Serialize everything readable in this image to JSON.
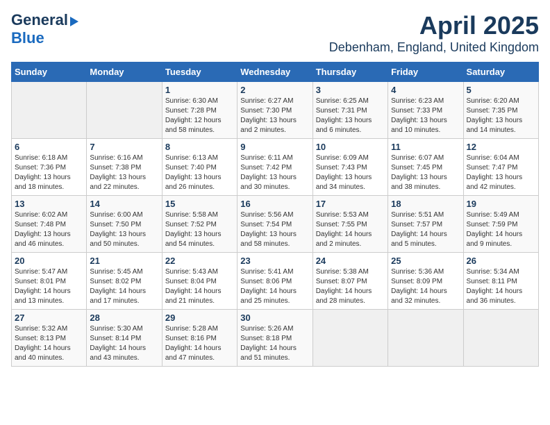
{
  "header": {
    "logo_line1": "General",
    "logo_line2": "Blue",
    "title": "April 2025",
    "subtitle": "Debenham, England, United Kingdom"
  },
  "calendar": {
    "days_of_week": [
      "Sunday",
      "Monday",
      "Tuesday",
      "Wednesday",
      "Thursday",
      "Friday",
      "Saturday"
    ],
    "weeks": [
      [
        {
          "day": "",
          "info": ""
        },
        {
          "day": "",
          "info": ""
        },
        {
          "day": "1",
          "info": "Sunrise: 6:30 AM\nSunset: 7:28 PM\nDaylight: 12 hours\nand 58 minutes."
        },
        {
          "day": "2",
          "info": "Sunrise: 6:27 AM\nSunset: 7:30 PM\nDaylight: 13 hours\nand 2 minutes."
        },
        {
          "day": "3",
          "info": "Sunrise: 6:25 AM\nSunset: 7:31 PM\nDaylight: 13 hours\nand 6 minutes."
        },
        {
          "day": "4",
          "info": "Sunrise: 6:23 AM\nSunset: 7:33 PM\nDaylight: 13 hours\nand 10 minutes."
        },
        {
          "day": "5",
          "info": "Sunrise: 6:20 AM\nSunset: 7:35 PM\nDaylight: 13 hours\nand 14 minutes."
        }
      ],
      [
        {
          "day": "6",
          "info": "Sunrise: 6:18 AM\nSunset: 7:36 PM\nDaylight: 13 hours\nand 18 minutes."
        },
        {
          "day": "7",
          "info": "Sunrise: 6:16 AM\nSunset: 7:38 PM\nDaylight: 13 hours\nand 22 minutes."
        },
        {
          "day": "8",
          "info": "Sunrise: 6:13 AM\nSunset: 7:40 PM\nDaylight: 13 hours\nand 26 minutes."
        },
        {
          "day": "9",
          "info": "Sunrise: 6:11 AM\nSunset: 7:42 PM\nDaylight: 13 hours\nand 30 minutes."
        },
        {
          "day": "10",
          "info": "Sunrise: 6:09 AM\nSunset: 7:43 PM\nDaylight: 13 hours\nand 34 minutes."
        },
        {
          "day": "11",
          "info": "Sunrise: 6:07 AM\nSunset: 7:45 PM\nDaylight: 13 hours\nand 38 minutes."
        },
        {
          "day": "12",
          "info": "Sunrise: 6:04 AM\nSunset: 7:47 PM\nDaylight: 13 hours\nand 42 minutes."
        }
      ],
      [
        {
          "day": "13",
          "info": "Sunrise: 6:02 AM\nSunset: 7:48 PM\nDaylight: 13 hours\nand 46 minutes."
        },
        {
          "day": "14",
          "info": "Sunrise: 6:00 AM\nSunset: 7:50 PM\nDaylight: 13 hours\nand 50 minutes."
        },
        {
          "day": "15",
          "info": "Sunrise: 5:58 AM\nSunset: 7:52 PM\nDaylight: 13 hours\nand 54 minutes."
        },
        {
          "day": "16",
          "info": "Sunrise: 5:56 AM\nSunset: 7:54 PM\nDaylight: 13 hours\nand 58 minutes."
        },
        {
          "day": "17",
          "info": "Sunrise: 5:53 AM\nSunset: 7:55 PM\nDaylight: 14 hours\nand 2 minutes."
        },
        {
          "day": "18",
          "info": "Sunrise: 5:51 AM\nSunset: 7:57 PM\nDaylight: 14 hours\nand 5 minutes."
        },
        {
          "day": "19",
          "info": "Sunrise: 5:49 AM\nSunset: 7:59 PM\nDaylight: 14 hours\nand 9 minutes."
        }
      ],
      [
        {
          "day": "20",
          "info": "Sunrise: 5:47 AM\nSunset: 8:01 PM\nDaylight: 14 hours\nand 13 minutes."
        },
        {
          "day": "21",
          "info": "Sunrise: 5:45 AM\nSunset: 8:02 PM\nDaylight: 14 hours\nand 17 minutes."
        },
        {
          "day": "22",
          "info": "Sunrise: 5:43 AM\nSunset: 8:04 PM\nDaylight: 14 hours\nand 21 minutes."
        },
        {
          "day": "23",
          "info": "Sunrise: 5:41 AM\nSunset: 8:06 PM\nDaylight: 14 hours\nand 25 minutes."
        },
        {
          "day": "24",
          "info": "Sunrise: 5:38 AM\nSunset: 8:07 PM\nDaylight: 14 hours\nand 28 minutes."
        },
        {
          "day": "25",
          "info": "Sunrise: 5:36 AM\nSunset: 8:09 PM\nDaylight: 14 hours\nand 32 minutes."
        },
        {
          "day": "26",
          "info": "Sunrise: 5:34 AM\nSunset: 8:11 PM\nDaylight: 14 hours\nand 36 minutes."
        }
      ],
      [
        {
          "day": "27",
          "info": "Sunrise: 5:32 AM\nSunset: 8:13 PM\nDaylight: 14 hours\nand 40 minutes."
        },
        {
          "day": "28",
          "info": "Sunrise: 5:30 AM\nSunset: 8:14 PM\nDaylight: 14 hours\nand 43 minutes."
        },
        {
          "day": "29",
          "info": "Sunrise: 5:28 AM\nSunset: 8:16 PM\nDaylight: 14 hours\nand 47 minutes."
        },
        {
          "day": "30",
          "info": "Sunrise: 5:26 AM\nSunset: 8:18 PM\nDaylight: 14 hours\nand 51 minutes."
        },
        {
          "day": "",
          "info": ""
        },
        {
          "day": "",
          "info": ""
        },
        {
          "day": "",
          "info": ""
        }
      ]
    ]
  }
}
